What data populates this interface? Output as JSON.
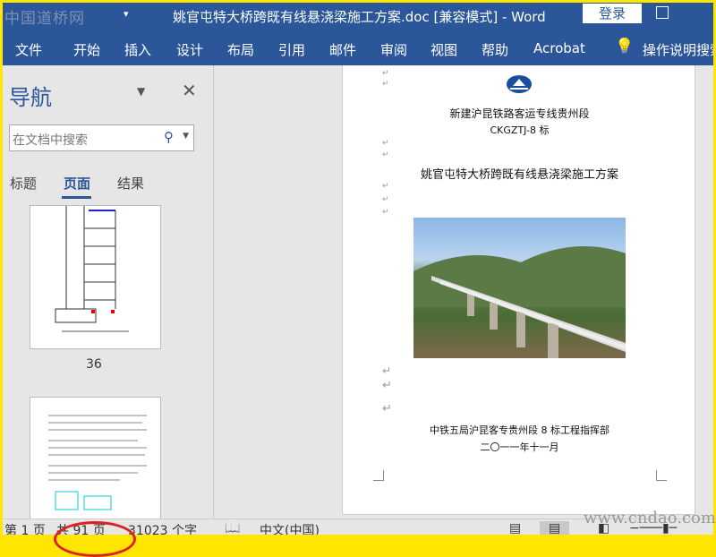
{
  "watermark_top": "中国道桥网",
  "title": "姚官屯特大桥跨既有线悬浇梁施工方案.doc [兼容模式]  -  Word",
  "login": "登录",
  "ribbon_tabs": [
    "文件",
    "开始",
    "插入",
    "设计",
    "布局",
    "引用",
    "邮件",
    "审阅",
    "视图",
    "帮助",
    "Acrobat"
  ],
  "tell_me": "操作说明搜索",
  "nav": {
    "title": "导航",
    "search_placeholder": "在文档中搜索",
    "tabs": [
      "标题",
      "页面",
      "结果"
    ],
    "page_number": "36"
  },
  "doc": {
    "line1": "新建沪昆铁路客运专线贵州段",
    "line2": "CKGZTJ-8 标",
    "line3": "姚官屯特大桥跨既有线悬浇梁施工方案",
    "line4": "中铁五局沪昆客专贵州段 8 标工程指挥部",
    "line5": "二〇一一年十一月"
  },
  "status": {
    "page": "第 1 页",
    "total": "共 91 页",
    "words": "31023 个字",
    "lang": "中文(中国)"
  },
  "watermark_bottom": "www.cndao.com",
  "colors": {
    "brand": "#2b579a",
    "border": "#ffe600"
  }
}
